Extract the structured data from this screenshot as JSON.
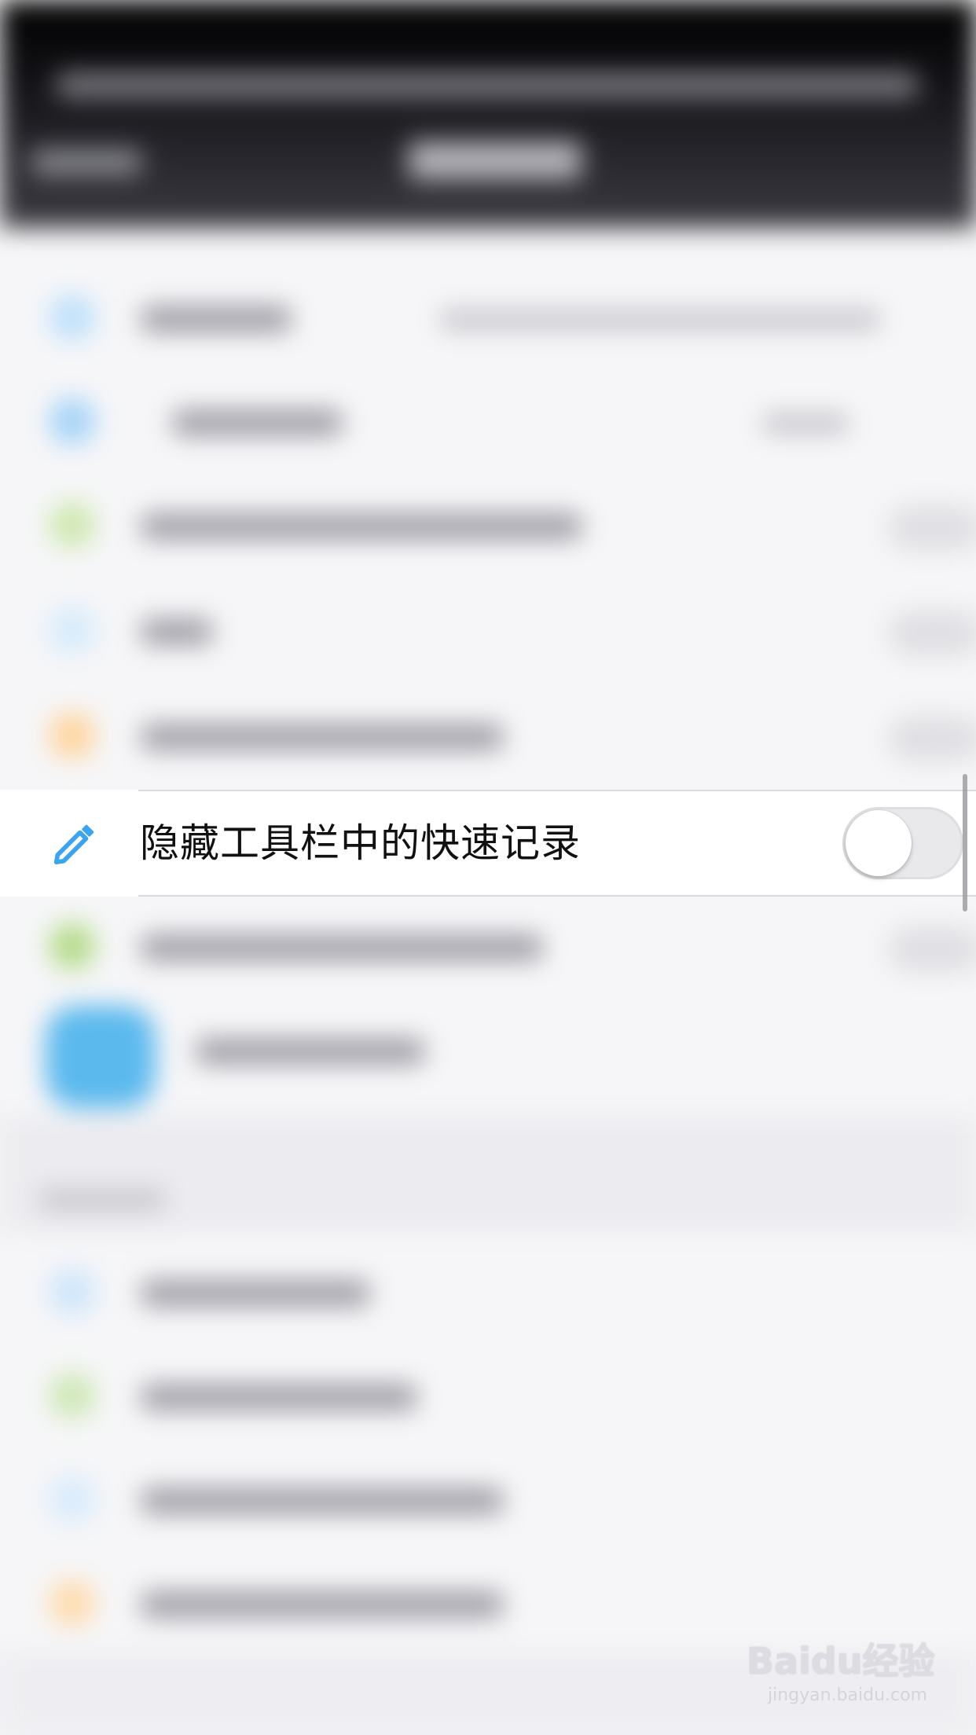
{
  "settings_row": {
    "label": "隐藏工具栏中的快速记录",
    "icon": "pencil-icon",
    "icon_color": "#3aa4ee",
    "toggle_on": false
  },
  "watermark": {
    "logo": "Baidu经验",
    "url": "jingyan.baidu.com"
  },
  "colors": {
    "header_background": "#1a1a1f",
    "list_background": "#f6f6f8",
    "row_background": "#ffffff",
    "toggle_track_off": "#e9e9ec",
    "accent_blue": "#3aa4ee",
    "accent_green": "#8fd160",
    "accent_orange": "#ffb74a"
  }
}
